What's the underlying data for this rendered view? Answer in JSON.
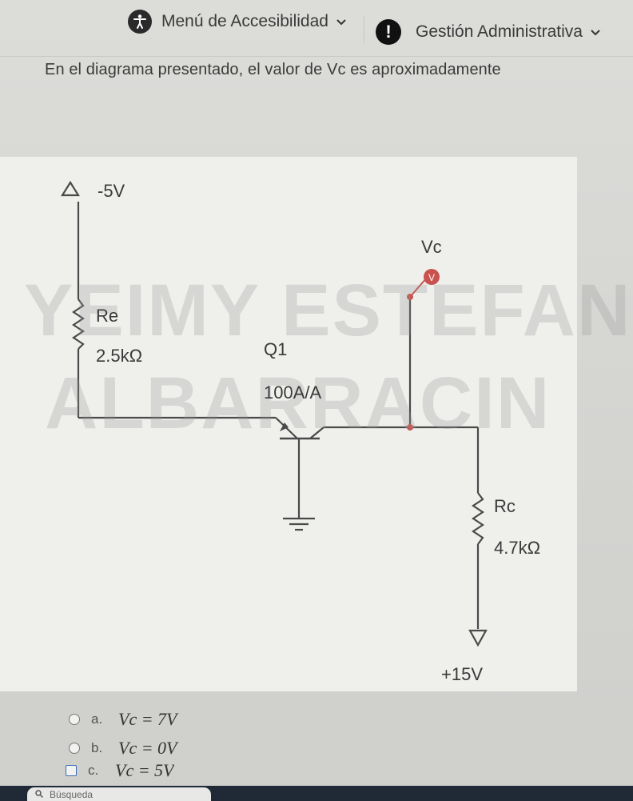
{
  "nav": {
    "accessibility_label": "Menú de Accesibilidad",
    "admin_label": "Gestión Administrativa"
  },
  "question": {
    "text": "En el diagrama presentado, el valor de Vc es aproximadamente"
  },
  "diagram": {
    "supply_neg": "-5V",
    "supply_pos": "+15V",
    "re_name": "Re",
    "re_value": "2.5kΩ",
    "rc_name": "Rc",
    "rc_value": "4.7kΩ",
    "transistor_name": "Q1",
    "transistor_gain": "100A/A",
    "probe_label": "Vc",
    "probe_badge": "V",
    "watermark_line1": "YEIMY ESTEFANI D",
    "watermark_line2": "ALBARRACIN"
  },
  "options": [
    {
      "letter": "a.",
      "expr": "Vc = 7V"
    },
    {
      "letter": "b.",
      "expr": "Vc = 0V"
    },
    {
      "letter": "c.",
      "expr": "Vc = 5V"
    }
  ],
  "taskbar": {
    "search_placeholder": "Búsqueda"
  },
  "colors": {
    "wire": "#4a4a4a",
    "probe": "#c9524e",
    "background": "#efefec"
  }
}
